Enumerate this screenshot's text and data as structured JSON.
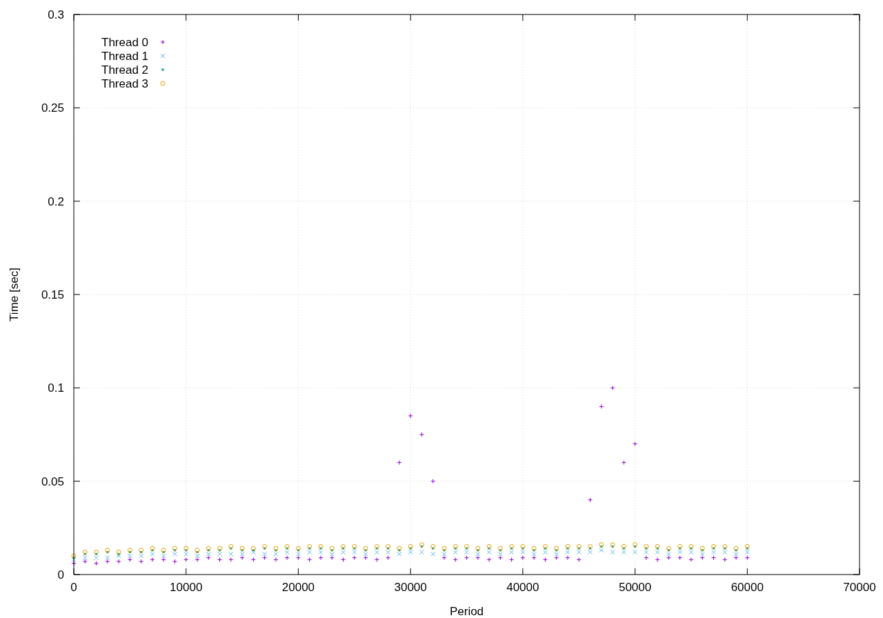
{
  "chart": {
    "chart_data": {
      "type": "scatter",
      "grid": true,
      "legend": "top-left",
      "xlabel": "Period",
      "ylabel": "Time [sec]",
      "xlim": [
        0,
        70000
      ],
      "ylim": [
        0,
        0.3
      ],
      "xticks": [
        0,
        10000,
        20000,
        30000,
        40000,
        50000,
        60000,
        70000
      ],
      "yticks": [
        {
          "value": 0,
          "label": "0"
        },
        {
          "value": 0.05,
          "label": "0.05"
        },
        {
          "value": 0.1,
          "label": "0.1"
        },
        {
          "value": 0.15,
          "label": "0.15"
        },
        {
          "value": 0.2,
          "label": "0.2"
        },
        {
          "value": 0.25,
          "label": "0.25"
        },
        {
          "value": 0.3,
          "label": "0.3"
        }
      ],
      "x": [
        0,
        1000,
        2000,
        3000,
        4000,
        5000,
        6000,
        7000,
        8000,
        9000,
        10000,
        11000,
        12000,
        13000,
        14000,
        15000,
        16000,
        17000,
        18000,
        19000,
        20000,
        21000,
        22000,
        23000,
        24000,
        25000,
        26000,
        27000,
        28000,
        29000,
        30000,
        31000,
        32000,
        33000,
        34000,
        35000,
        36000,
        37000,
        38000,
        39000,
        40000,
        41000,
        42000,
        43000,
        44000,
        45000,
        46000,
        47000,
        48000,
        49000,
        50000,
        51000,
        52000,
        53000,
        54000,
        55000,
        56000,
        57000,
        58000,
        59000,
        60000
      ],
      "series": [
        {
          "name": "Thread 0",
          "color": "#9400d3",
          "marker": "plus",
          "values": [
            0.006,
            0.007,
            0.006,
            0.007,
            0.007,
            0.008,
            0.007,
            0.008,
            0.008,
            0.007,
            0.008,
            0.008,
            0.009,
            0.008,
            0.008,
            0.009,
            0.008,
            0.009,
            0.008,
            0.009,
            0.009,
            0.008,
            0.009,
            0.009,
            0.008,
            0.009,
            0.009,
            0.008,
            0.009,
            0.06,
            0.085,
            0.075,
            0.05,
            0.009,
            0.008,
            0.009,
            0.009,
            0.008,
            0.009,
            0.008,
            0.009,
            0.009,
            0.008,
            0.009,
            0.009,
            0.008,
            0.04,
            0.09,
            0.1,
            0.06,
            0.07,
            0.009,
            0.008,
            0.009,
            0.009,
            0.008,
            0.009,
            0.009,
            0.008,
            0.009,
            0.009
          ]
        },
        {
          "name": "Thread 1",
          "color": "#56b4e9",
          "marker": "cross",
          "values": [
            0.008,
            0.009,
            0.009,
            0.009,
            0.01,
            0.01,
            0.01,
            0.011,
            0.01,
            0.011,
            0.011,
            0.01,
            0.011,
            0.011,
            0.011,
            0.011,
            0.012,
            0.011,
            0.011,
            0.012,
            0.011,
            0.012,
            0.012,
            0.011,
            0.012,
            0.012,
            0.011,
            0.012,
            0.012,
            0.011,
            0.012,
            0.012,
            0.011,
            0.011,
            0.012,
            0.012,
            0.011,
            0.012,
            0.011,
            0.012,
            0.012,
            0.011,
            0.012,
            0.011,
            0.012,
            0.012,
            0.012,
            0.013,
            0.012,
            0.012,
            0.012,
            0.012,
            0.012,
            0.011,
            0.012,
            0.012,
            0.011,
            0.012,
            0.012,
            0.011,
            0.012
          ]
        },
        {
          "name": "Thread 2",
          "color": "#009e73",
          "marker": "square",
          "values": [
            0.009,
            0.011,
            0.011,
            0.012,
            0.011,
            0.012,
            0.012,
            0.013,
            0.012,
            0.013,
            0.013,
            0.012,
            0.013,
            0.013,
            0.014,
            0.013,
            0.013,
            0.014,
            0.013,
            0.014,
            0.013,
            0.014,
            0.014,
            0.013,
            0.014,
            0.014,
            0.013,
            0.014,
            0.014,
            0.013,
            0.014,
            0.015,
            0.014,
            0.013,
            0.014,
            0.014,
            0.013,
            0.014,
            0.013,
            0.014,
            0.014,
            0.013,
            0.014,
            0.013,
            0.014,
            0.014,
            0.014,
            0.015,
            0.015,
            0.014,
            0.015,
            0.014,
            0.014,
            0.013,
            0.014,
            0.014,
            0.013,
            0.014,
            0.014,
            0.013,
            0.014
          ]
        },
        {
          "name": "Thread 3",
          "color": "#e69f00",
          "marker": "circle",
          "values": [
            0.01,
            0.012,
            0.012,
            0.013,
            0.012,
            0.013,
            0.013,
            0.014,
            0.013,
            0.014,
            0.014,
            0.013,
            0.014,
            0.014,
            0.015,
            0.014,
            0.014,
            0.015,
            0.014,
            0.015,
            0.014,
            0.015,
            0.015,
            0.014,
            0.015,
            0.015,
            0.014,
            0.015,
            0.015,
            0.014,
            0.015,
            0.016,
            0.015,
            0.014,
            0.015,
            0.015,
            0.014,
            0.015,
            0.014,
            0.015,
            0.015,
            0.014,
            0.015,
            0.014,
            0.015,
            0.015,
            0.015,
            0.016,
            0.016,
            0.015,
            0.016,
            0.015,
            0.015,
            0.014,
            0.015,
            0.015,
            0.014,
            0.015,
            0.015,
            0.014,
            0.015
          ]
        }
      ]
    }
  }
}
